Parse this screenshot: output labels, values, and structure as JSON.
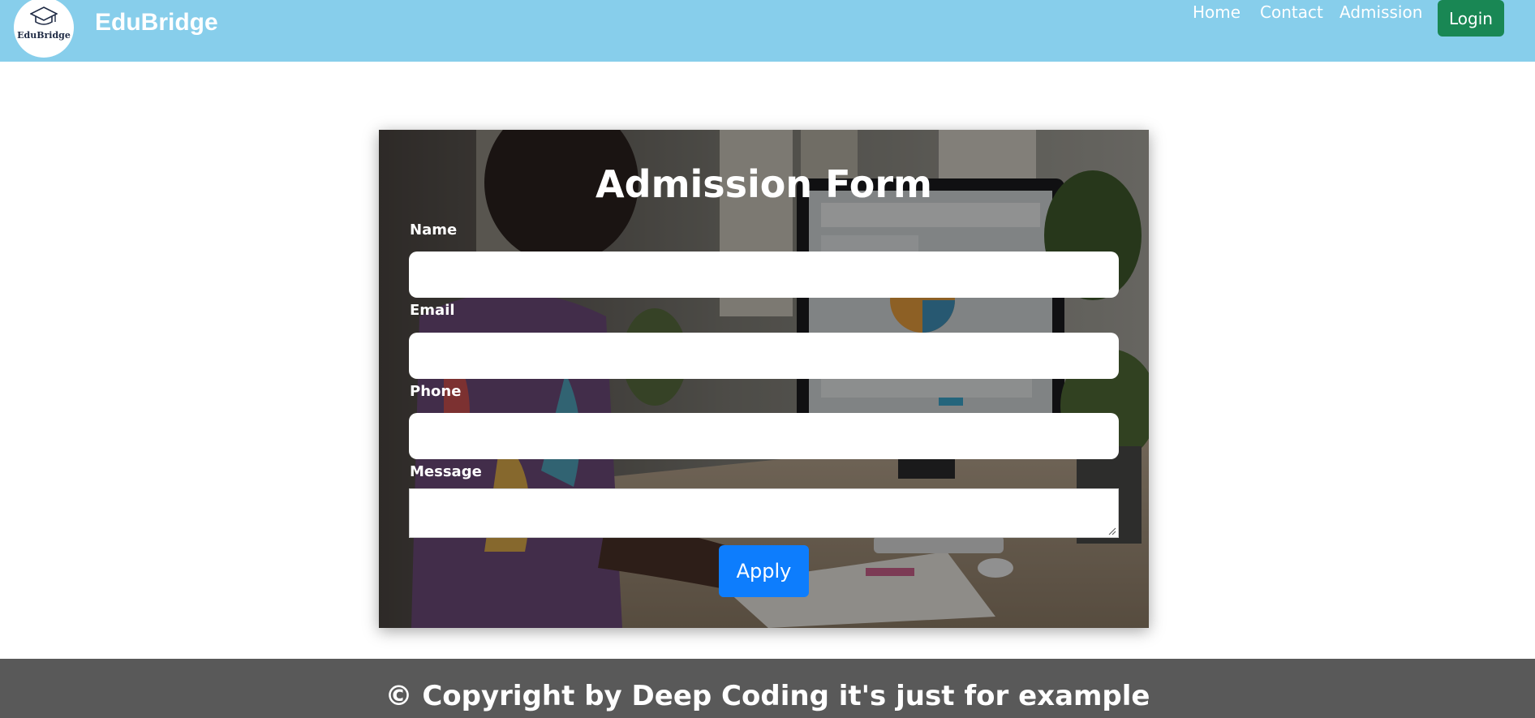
{
  "header": {
    "brand": "EduBridge",
    "logo_text": "EduBridge",
    "nav": [
      {
        "label": "Home"
      },
      {
        "label": "Contact"
      },
      {
        "label": "Admission"
      }
    ],
    "login_label": "Login",
    "colors": {
      "navbar": "#87ceeb",
      "login": "#198754"
    }
  },
  "form": {
    "title": "Admission Form",
    "fields": {
      "name_label": "Name",
      "email_label": "Email",
      "phone_label": "Phone",
      "message_label": "Message"
    },
    "apply_label": "Apply",
    "colors": {
      "apply": "#0d7dfd"
    }
  },
  "footer": {
    "text": "© Copyright by Deep Coding it's just for example",
    "color": "#595959"
  }
}
